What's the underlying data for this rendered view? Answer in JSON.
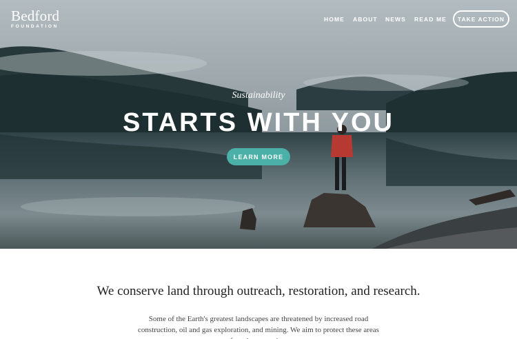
{
  "brand": {
    "name": "Bedford",
    "tagline": "FOUNDATION"
  },
  "nav": {
    "items": [
      {
        "label": "HOME"
      },
      {
        "label": "ABOUT"
      },
      {
        "label": "NEWS"
      },
      {
        "label": "READ ME"
      }
    ],
    "cta_label": "TAKE ACTION"
  },
  "hero": {
    "eyebrow": "Sustainability",
    "headline": "STARTS WITH YOU",
    "button_label": "LEARN MORE"
  },
  "intro": {
    "heading": "We conserve land through outreach, restoration, and research.",
    "body": "Some of the Earth's greatest landscapes are threatened by increased road construction, oil and gas exploration, and mining. We aim to protect these areas from inappropriate"
  },
  "colors": {
    "accent": "#4bb0a8",
    "text_dark": "#222222"
  }
}
